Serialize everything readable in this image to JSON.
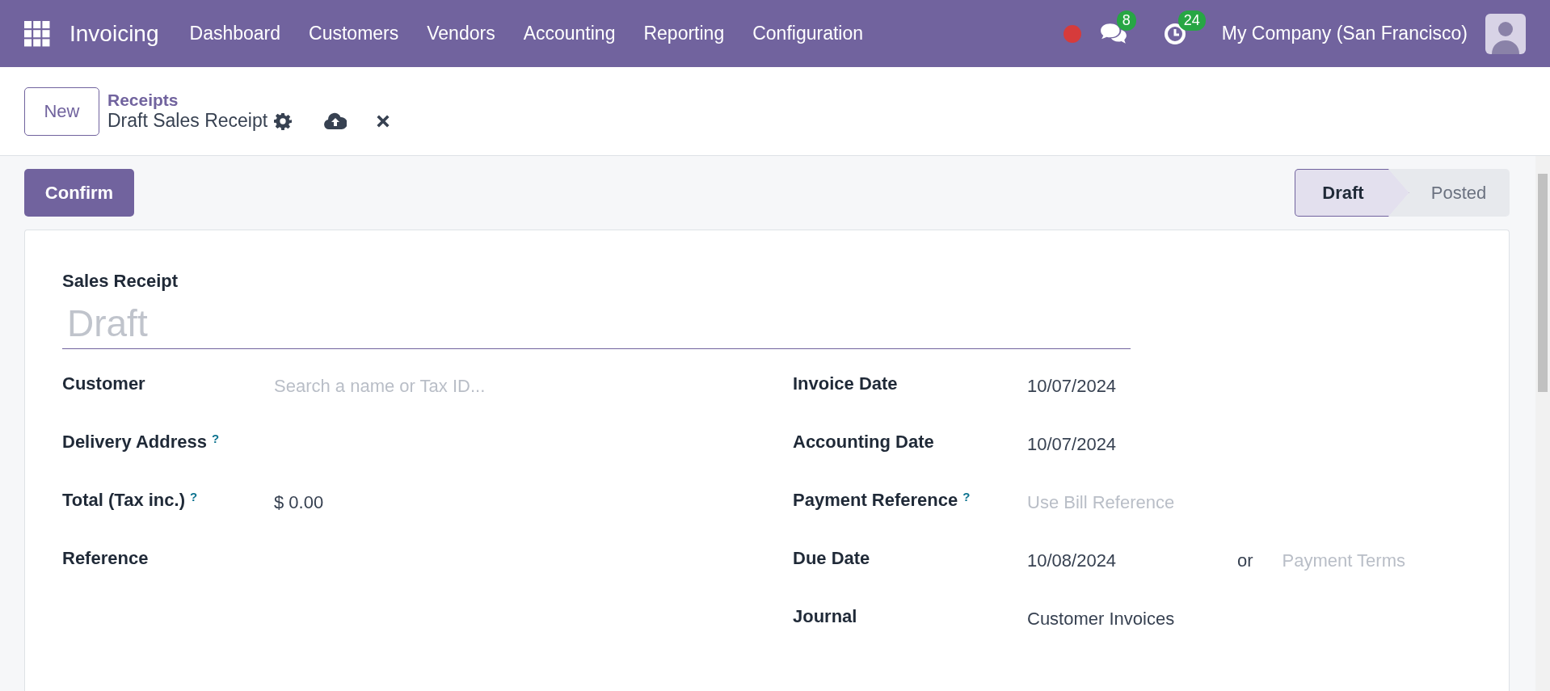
{
  "navbar": {
    "app_name": "Invoicing",
    "menu": [
      "Dashboard",
      "Customers",
      "Vendors",
      "Accounting",
      "Reporting",
      "Configuration"
    ],
    "messages_count": "8",
    "activities_count": "24",
    "company": "My Company (San Francisco)"
  },
  "control_panel": {
    "new_button": "New",
    "breadcrumb_parent": "Receipts",
    "breadcrumb_current": "Draft Sales Receipt"
  },
  "actions": {
    "confirm": "Confirm"
  },
  "statusbar": [
    {
      "label": "Draft",
      "selected": true
    },
    {
      "label": "Posted",
      "selected": false
    }
  ],
  "form": {
    "title_label": "Sales Receipt",
    "name_placeholder": "Draft",
    "left_fields": [
      {
        "label": "Customer",
        "placeholder": "Search a name or Tax ID..."
      },
      {
        "label": "Delivery Address",
        "help": "?"
      },
      {
        "label": "Total (Tax inc.)",
        "help": "?",
        "value": "$ 0.00"
      },
      {
        "label": "Reference"
      }
    ],
    "right_fields": [
      {
        "label": "Invoice Date",
        "value": "10/07/2024"
      },
      {
        "label": "Accounting Date",
        "value": "10/07/2024"
      },
      {
        "label": "Payment Reference",
        "help": "?",
        "placeholder": "Use Bill Reference"
      },
      {
        "label": "Due Date",
        "value": "10/08/2024",
        "separator": "or",
        "second_placeholder": "Payment Terms"
      },
      {
        "label": "Journal",
        "value": "Customer Invoices"
      }
    ]
  }
}
